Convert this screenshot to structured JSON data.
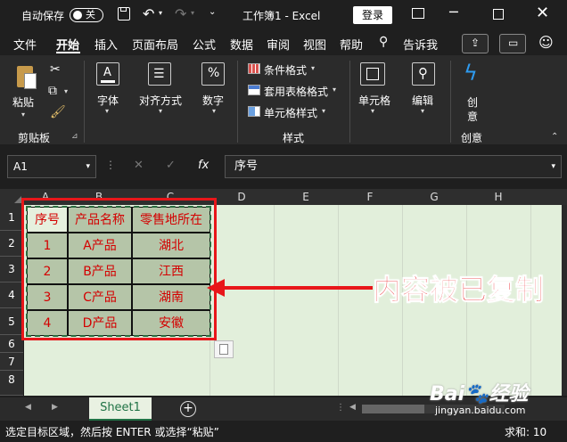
{
  "titlebar": {
    "autosave_label": "自动保存",
    "autosave_state": "关",
    "doc_title": "工作簿1 - Excel",
    "login_label": "登录"
  },
  "menu": {
    "tabs": [
      "文件",
      "开始",
      "插入",
      "页面布局",
      "公式",
      "数据",
      "审阅",
      "视图",
      "帮助"
    ],
    "active_tab": "开始",
    "tell_me": "告诉我"
  },
  "ribbon": {
    "paste": "粘贴",
    "clipboard_group": "剪贴板",
    "font": "字体",
    "align": "对齐方式",
    "number": "数字",
    "conditional": "条件格式",
    "table_format": "套用表格格式",
    "cell_style": "单元格样式",
    "styles_group": "样式",
    "cells": "单元格",
    "edit": "编辑",
    "create_line1": "创",
    "create_line2": "意",
    "create_group": "创意",
    "icons": {
      "number": "%",
      "fx": "fx"
    }
  },
  "formula_bar": {
    "name_box": "A1",
    "content": "序号"
  },
  "grid": {
    "columns": [
      "A",
      "B",
      "C",
      "D",
      "E",
      "F",
      "G",
      "H"
    ],
    "rows": [
      "1",
      "2",
      "3",
      "4",
      "5",
      "6",
      "7",
      "8"
    ],
    "table": {
      "headers": [
        "序号",
        "产品名称",
        "零售地所在"
      ],
      "rows": [
        [
          "1",
          "A产品",
          "湖北"
        ],
        [
          "2",
          "B产品",
          "江西"
        ],
        [
          "3",
          "C产品",
          "湖南"
        ],
        [
          "4",
          "D产品",
          "安徽"
        ]
      ]
    }
  },
  "annotation": {
    "text": "内容被已复制",
    "color": "#e8161a"
  },
  "sheet_tabs": {
    "active": "Sheet1",
    "add": "+"
  },
  "status": {
    "message": "选定目标区域，然后按 ENTER 或选择“粘贴”",
    "sum": "求和: 10"
  },
  "watermark": {
    "text": "jingyan.baidu.com"
  }
}
